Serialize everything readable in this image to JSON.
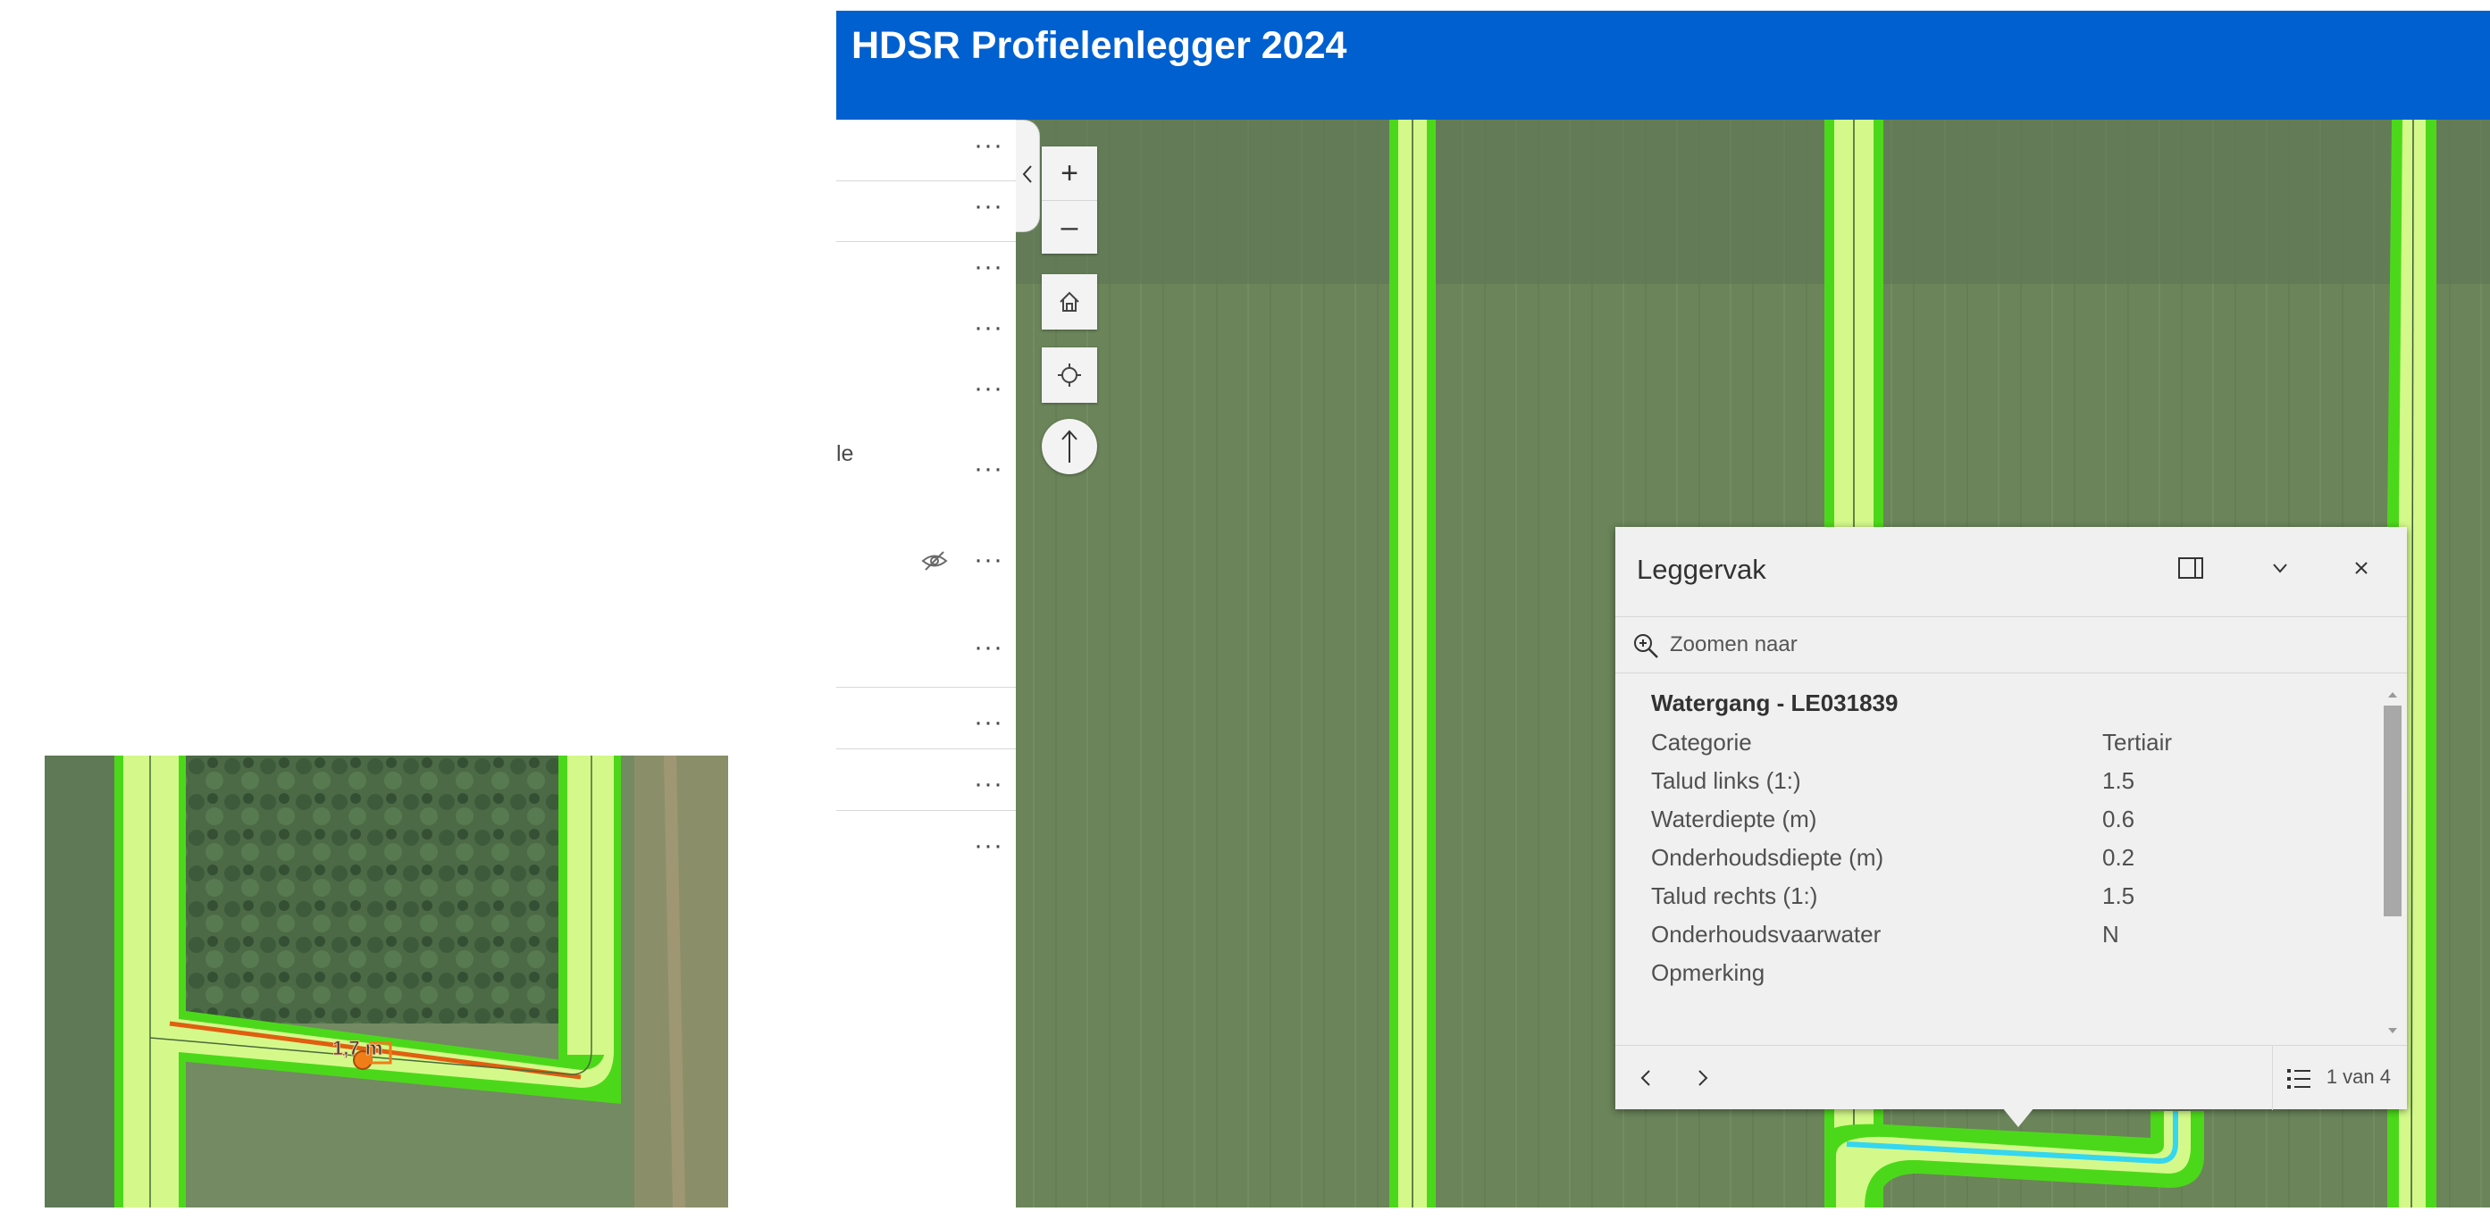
{
  "inset": {
    "measurement_label": "1,7 m"
  },
  "app": {
    "title": "HDSR Profielenlegger 2024"
  },
  "layer_panel": {
    "collapse_icon": "chevron-left-icon",
    "rows": [
      {
        "label": "",
        "more_label": "···",
        "icons": []
      },
      {
        "label": "",
        "more_label": "···",
        "icons": []
      },
      {
        "label": "",
        "more_label": "···",
        "icons": []
      },
      {
        "label": "",
        "more_label": "···",
        "icons": []
      },
      {
        "label": "",
        "more_label": "···",
        "icons": []
      },
      {
        "label": "le",
        "more_label": "···",
        "icons": []
      },
      {
        "label": "",
        "more_label": "···",
        "icons": [
          "eye-off-icon"
        ]
      },
      {
        "label": "",
        "more_label": "···",
        "icons": []
      },
      {
        "label": "",
        "more_label": "···",
        "icons": []
      },
      {
        "label": "",
        "more_label": "···",
        "icons": []
      },
      {
        "label": "",
        "more_label": "···",
        "icons": []
      }
    ]
  },
  "map_widgets": {
    "zoom_in": "+",
    "zoom_out": "–",
    "home_icon": "home-icon",
    "locate_icon": "locate-icon",
    "compass_icon": "compass-arrow-icon"
  },
  "popup": {
    "title": "Leggervak",
    "dock_icon": "dock-icon",
    "collapse_icon": "chevron-down-icon",
    "close_icon": "close-icon",
    "zoom_to_label": "Zoomen naar",
    "feature_title": "Watergang - LE031839",
    "attributes": [
      {
        "name": "Categorie",
        "value": "Tertiair"
      },
      {
        "name": "Talud links (1:)",
        "value": "1.5"
      },
      {
        "name": "Waterdiepte (m)",
        "value": "0.6"
      },
      {
        "name": "Onderhoudsdiepte (m)",
        "value": "0.2"
      },
      {
        "name": "Talud rechts (1:)",
        "value": "1.5"
      },
      {
        "name": "Onderhoudsvaarwater",
        "value": "N"
      },
      {
        "name": "Opmerking",
        "value": ""
      }
    ],
    "pager": "1 van 4"
  },
  "colors": {
    "header": "#0060d0",
    "canal_green": "#4cd81a",
    "canal_fill": "#d4f98a",
    "selection_cyan": "#35d6f0",
    "measure_orange": "#f07d18"
  }
}
